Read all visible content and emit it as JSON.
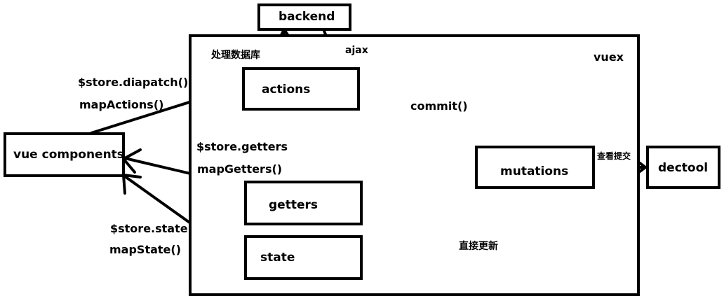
{
  "nodes": {
    "backend": "backend",
    "vuex": "vuex",
    "actions": "actions",
    "mutations": "mutations",
    "getters": "getters",
    "state": "state",
    "vue_components": "vue components",
    "dectool": "dectool"
  },
  "edges": {
    "dispatch": "$store.diapatch()",
    "map_actions": "mapActions()",
    "commit": "commit()",
    "store_getters": "$store.getters",
    "map_getters": "mapGetters()",
    "store_state": "$store.state",
    "map_state": "mapState()",
    "ajax": "ajax",
    "process_data": "处理数据库",
    "view_commit": "查看提交",
    "direct_update": "直接更新"
  }
}
